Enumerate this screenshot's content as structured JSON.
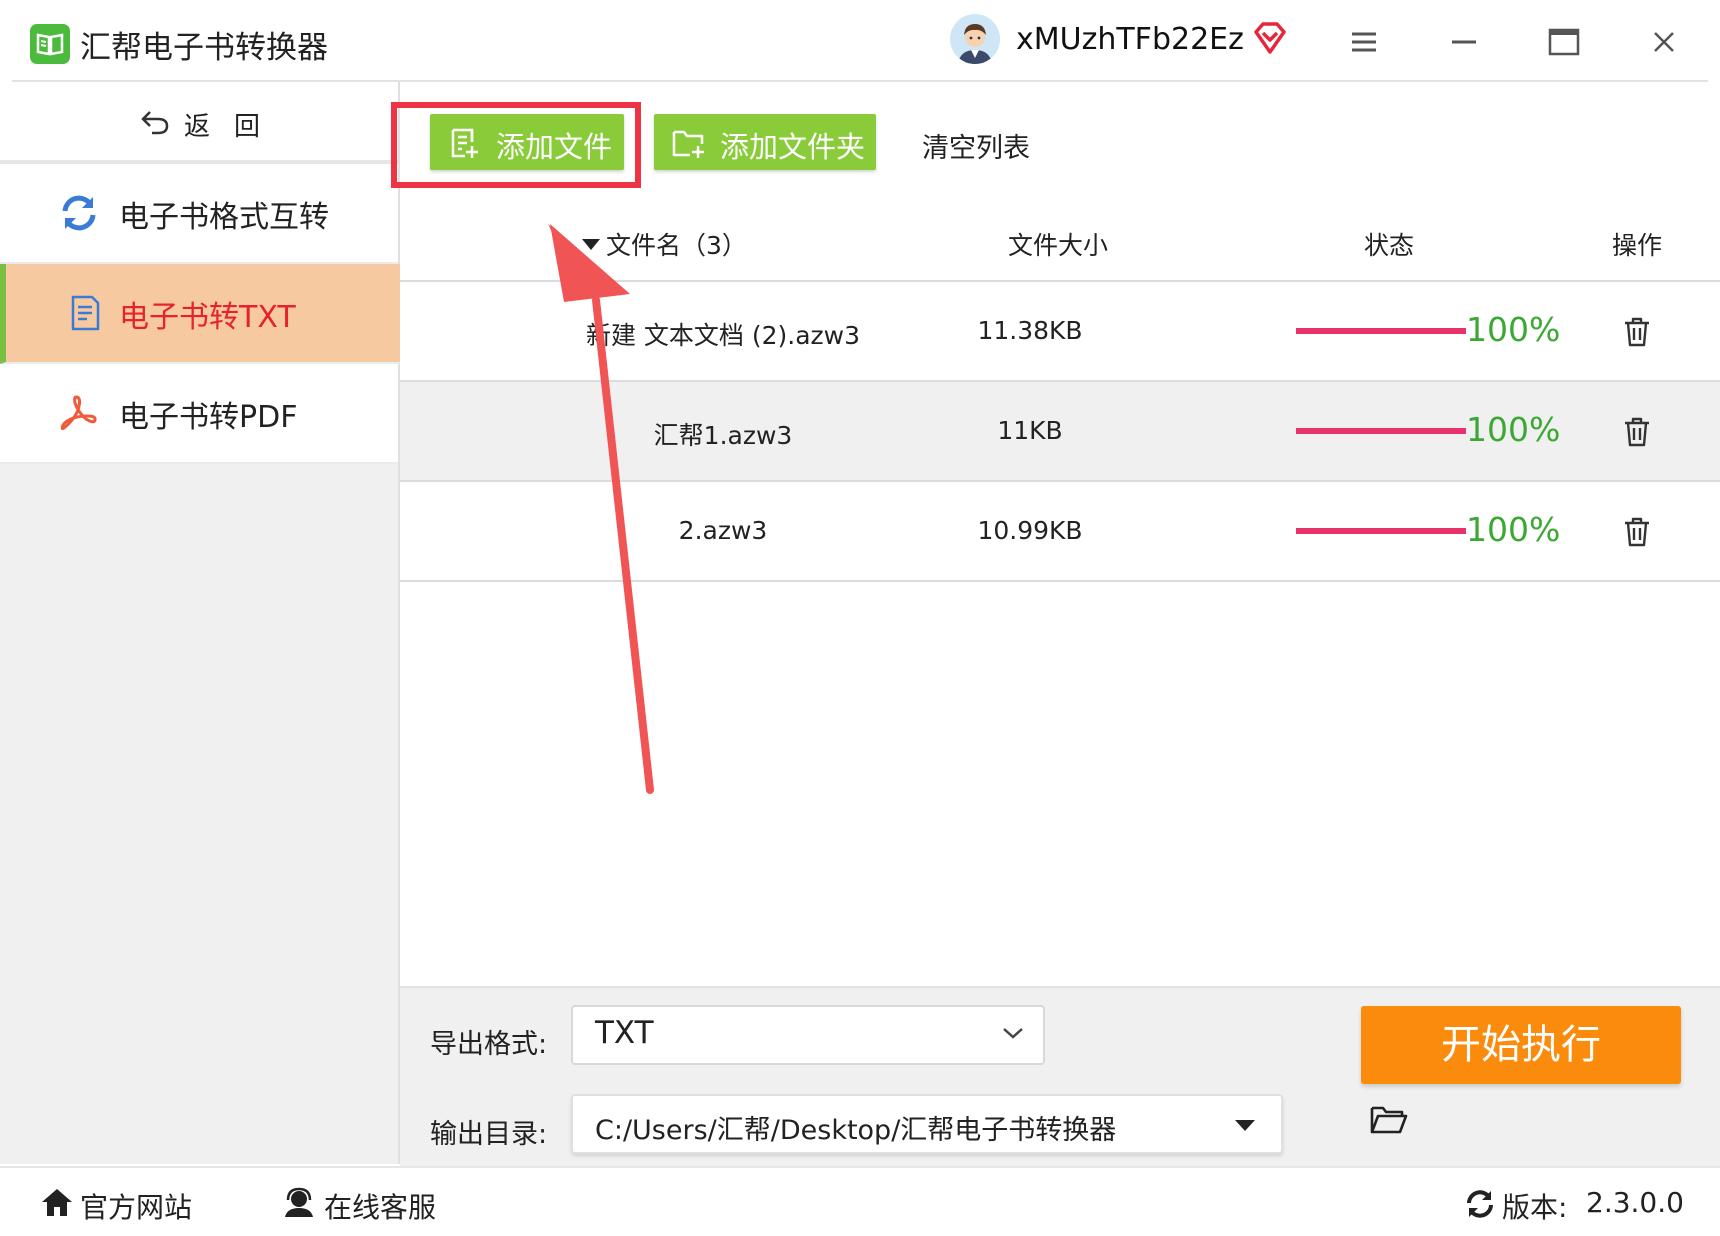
{
  "app": {
    "title": "汇帮电子书转换器",
    "username": "xMUzhTFb22Ez"
  },
  "sidebar": {
    "back_label": "返回",
    "items": [
      {
        "label": "电子书格式互转",
        "icon": "refresh-icon",
        "active": false
      },
      {
        "label": "电子书转TXT",
        "icon": "document-icon",
        "active": true
      },
      {
        "label": "电子书转PDF",
        "icon": "pdf-icon",
        "active": false
      }
    ]
  },
  "toolbar": {
    "add_file_label": "添加文件",
    "add_folder_label": "添加文件夹",
    "clear_list_label": "清空列表"
  },
  "table": {
    "headers": {
      "name": "文件名（3）",
      "size": "文件大小",
      "status": "状态",
      "ops": "操作"
    },
    "rows": [
      {
        "name": "新建 文本文档 (2).azw3",
        "size": "11.38KB",
        "progress": 1.0,
        "status_text": "100%"
      },
      {
        "name": "汇帮1.azw3",
        "size": "11KB",
        "progress": 1.0,
        "status_text": "100%"
      },
      {
        "name": "2.azw3",
        "size": "10.99KB",
        "progress": 1.0,
        "status_text": "100%"
      }
    ]
  },
  "output": {
    "format_label": "导出格式:",
    "format_value": "TXT",
    "dir_label": "输出目录:",
    "dir_value": "C:/Users/汇帮/Desktop/汇帮电子书转换器",
    "start_label": "开始执行"
  },
  "footer": {
    "site_label": "官方网站",
    "service_label": "在线客服",
    "version_label": "版本:",
    "version_value": "2.3.0.0"
  },
  "colors": {
    "accent_green": "#8acb3a",
    "active_bg": "#f7c9a0",
    "active_text": "#e5232a",
    "progress_bar": "#e8336a",
    "progress_text": "#3aa832",
    "start_button": "#fb8b0d",
    "highlight": "#ee3344"
  }
}
